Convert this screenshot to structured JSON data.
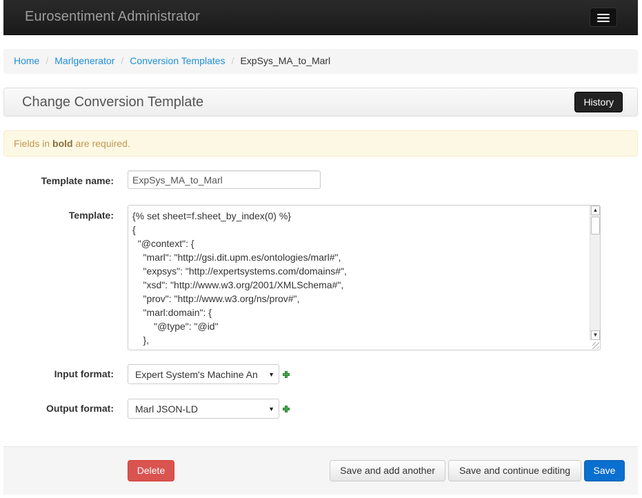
{
  "navbar": {
    "brand": "Eurosentiment Administrator",
    "menu_icon": "hamburger-icon"
  },
  "breadcrumb": {
    "items": [
      "Home",
      "Marlgenerator",
      "Conversion Templates"
    ],
    "current": "ExpSys_MA_to_Marl",
    "separator": "/"
  },
  "header": {
    "title": "Change Conversion Template",
    "history_label": "History"
  },
  "alert": {
    "prefix": "Fields in ",
    "bold": "bold",
    "suffix": " are required."
  },
  "form": {
    "template_name_label": "Template name:",
    "template_name_value": "ExpSys_MA_to_Marl",
    "template_label": "Template:",
    "template_lines": [
      "{% set sheet=f.sheet_by_index(0) %}",
      "{",
      "  \"@context\": {",
      "    \"marl\": \"http://gsi.dit.upm.es/ontologies/marl#\",",
      "    \"expsys\": \"http://expertsystems.com/domains#\",",
      "    \"xsd\": \"http://www.w3.org/2001/XMLSchema#\",",
      "    \"prov\": \"http://www.w3.org/ns/prov#\",",
      "    \"marl:domain\": {",
      "        \"@type\": \"@id\"",
      "    },"
    ],
    "input_format_label": "Input format:",
    "input_format_value": "Expert System's Machine An",
    "output_format_label": "Output format:",
    "output_format_value": "Marl JSON-LD",
    "add_icon": "plus-icon",
    "dropdown_icon": "caret-down-icon"
  },
  "actions": {
    "delete_label": "Delete",
    "save_add_label": "Save and add another",
    "save_continue_label": "Save and continue editing",
    "save_label": "Save"
  },
  "colors": {
    "link": "#1f8fd8",
    "danger": "#d9534f",
    "primary": "#0b6fcf",
    "alert_text": "#c09853",
    "plus": "#4caf50"
  }
}
